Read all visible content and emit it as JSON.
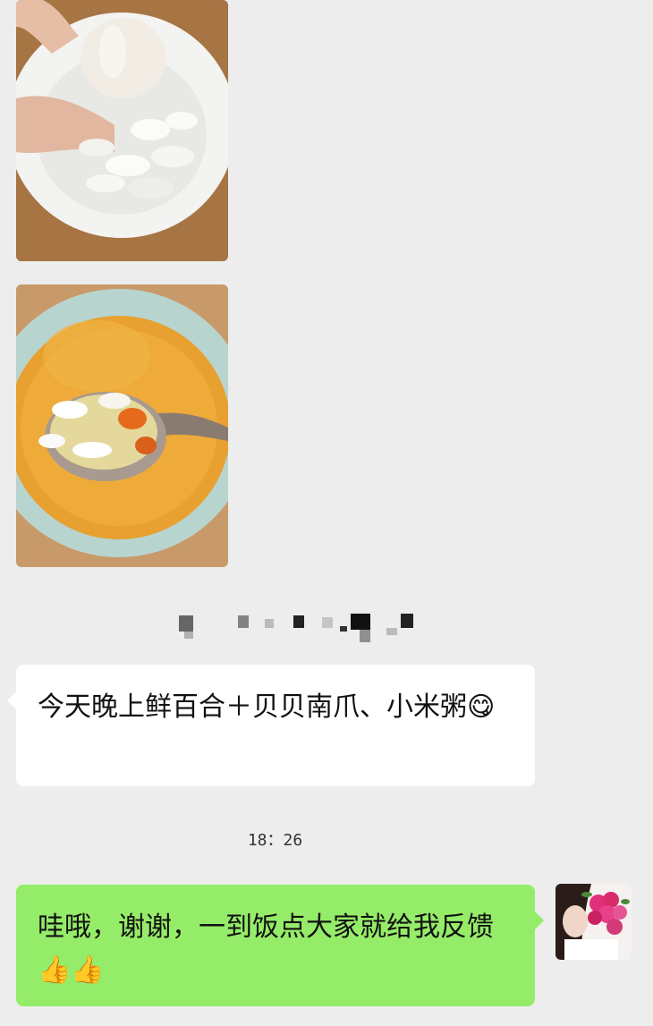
{
  "chat": {
    "photo1": {
      "icon": "garlic-and-lily-bulb-photo"
    },
    "photo2": {
      "icon": "pumpkin-millet-porridge-photo"
    },
    "sender_name_blurred": true,
    "message_in": {
      "text": "今天晚上鲜百合＋贝贝南爪、小米粥",
      "emoji": "😋"
    },
    "timestamp": "18：26",
    "message_out": {
      "text": "哇哦，谢谢，一到饭点大家就给我反馈",
      "emoji": "👍👍"
    },
    "avatar": {
      "icon": "avatar-with-flowers"
    }
  },
  "colors": {
    "background": "#ededed",
    "bubble_in": "#ffffff",
    "bubble_out": "#95ec69"
  }
}
